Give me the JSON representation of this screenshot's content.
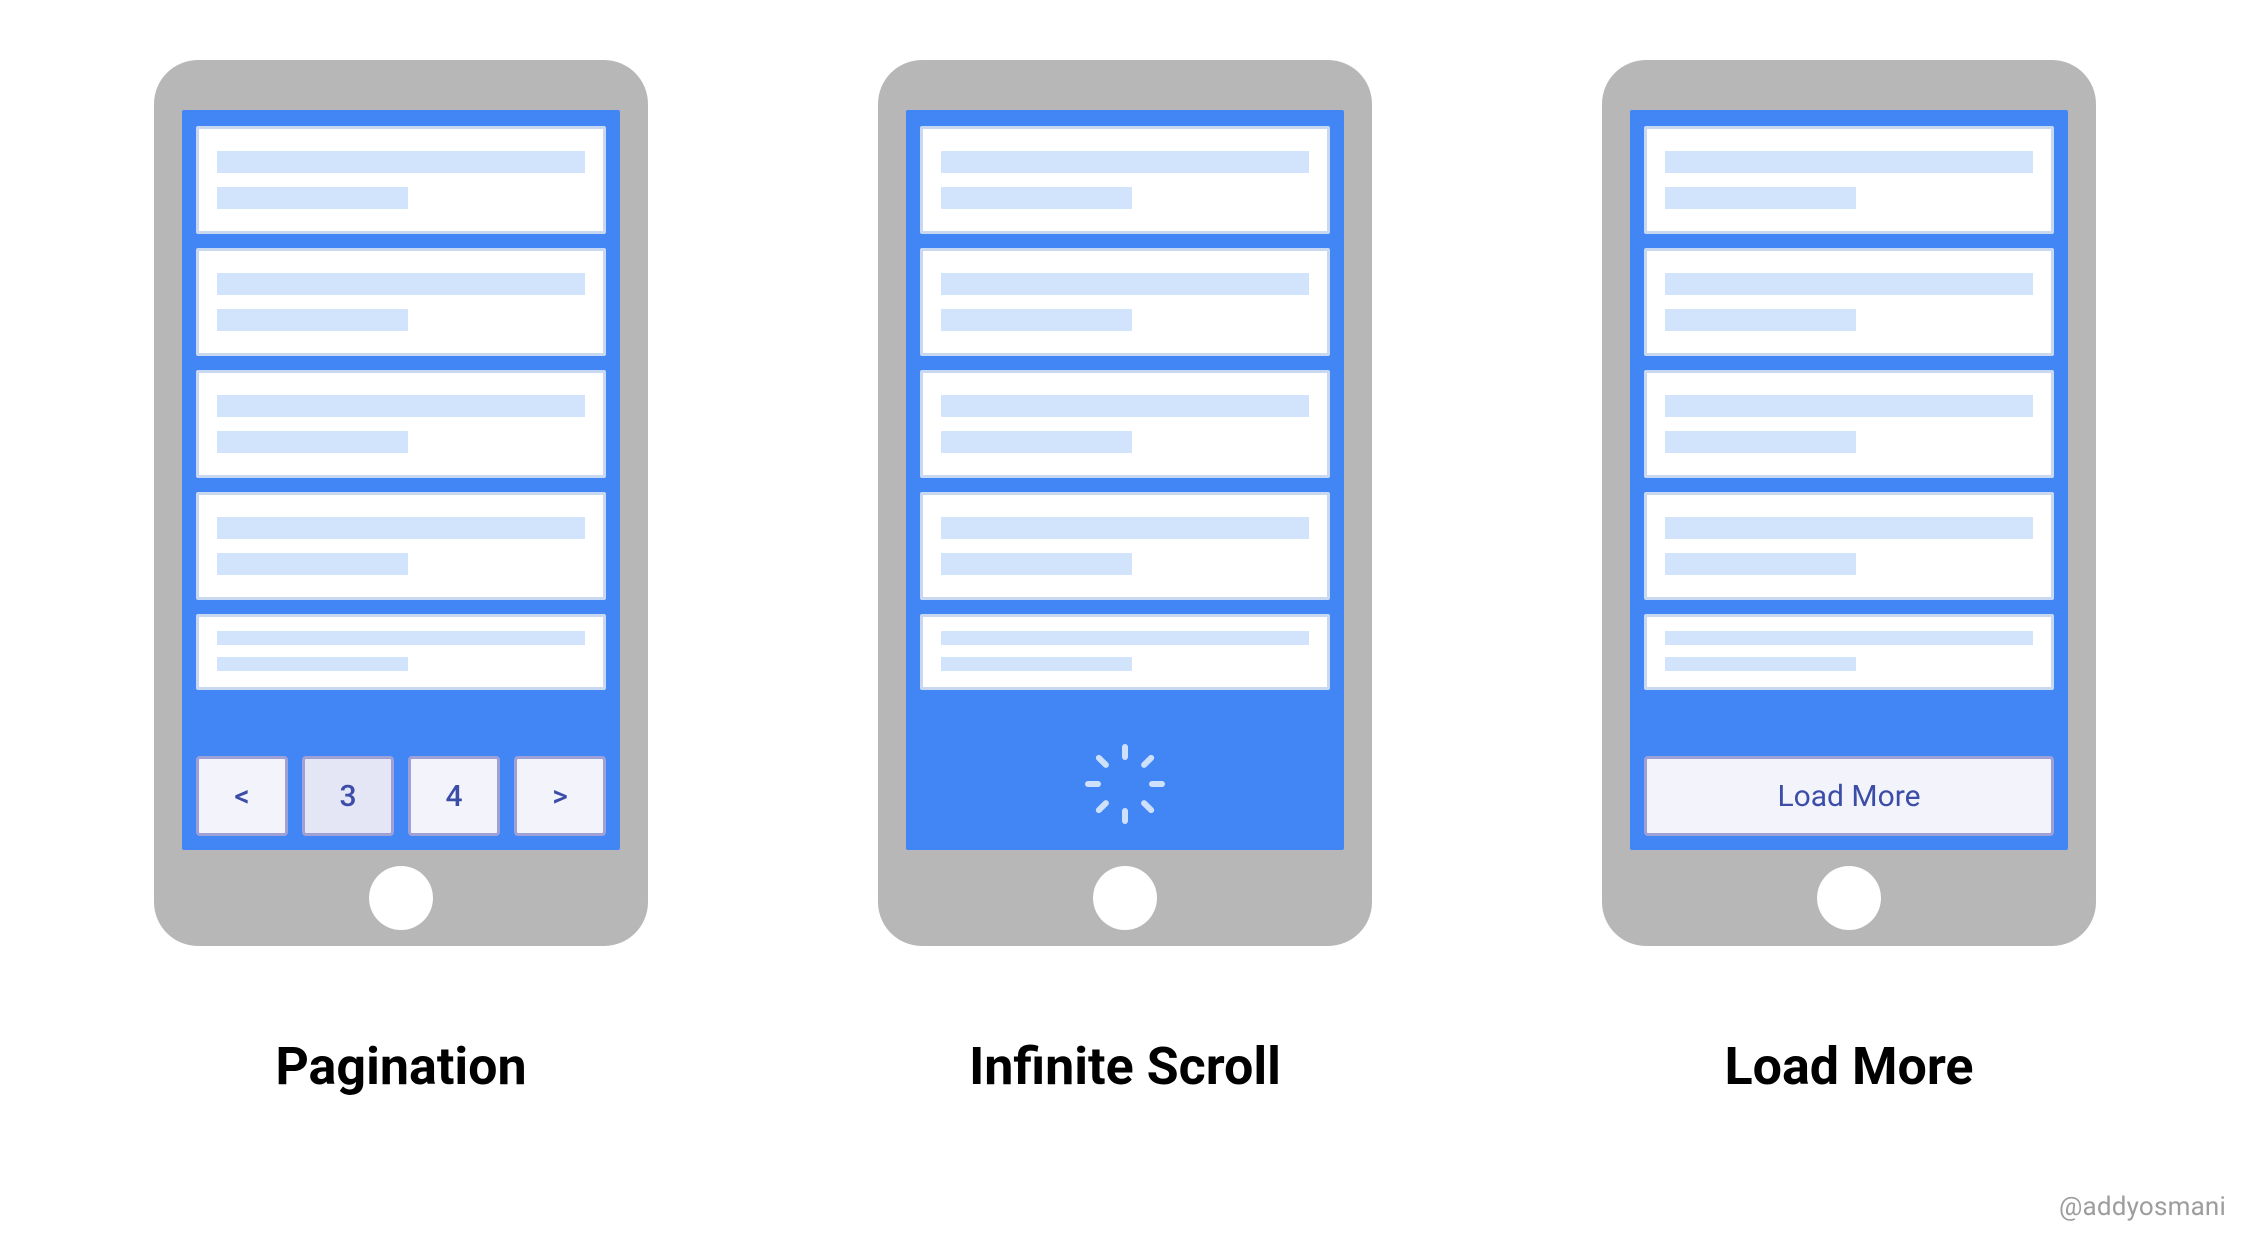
{
  "credit": "@addyosmani",
  "phones": {
    "pagination": {
      "caption": "Pagination",
      "pager": {
        "prev": "<",
        "pages": [
          "3",
          "4"
        ],
        "next": ">",
        "active_index": 0
      }
    },
    "infinite_scroll": {
      "caption": "Infinite Scroll"
    },
    "load_more": {
      "caption": "Load More",
      "button_label": "Load More"
    }
  }
}
